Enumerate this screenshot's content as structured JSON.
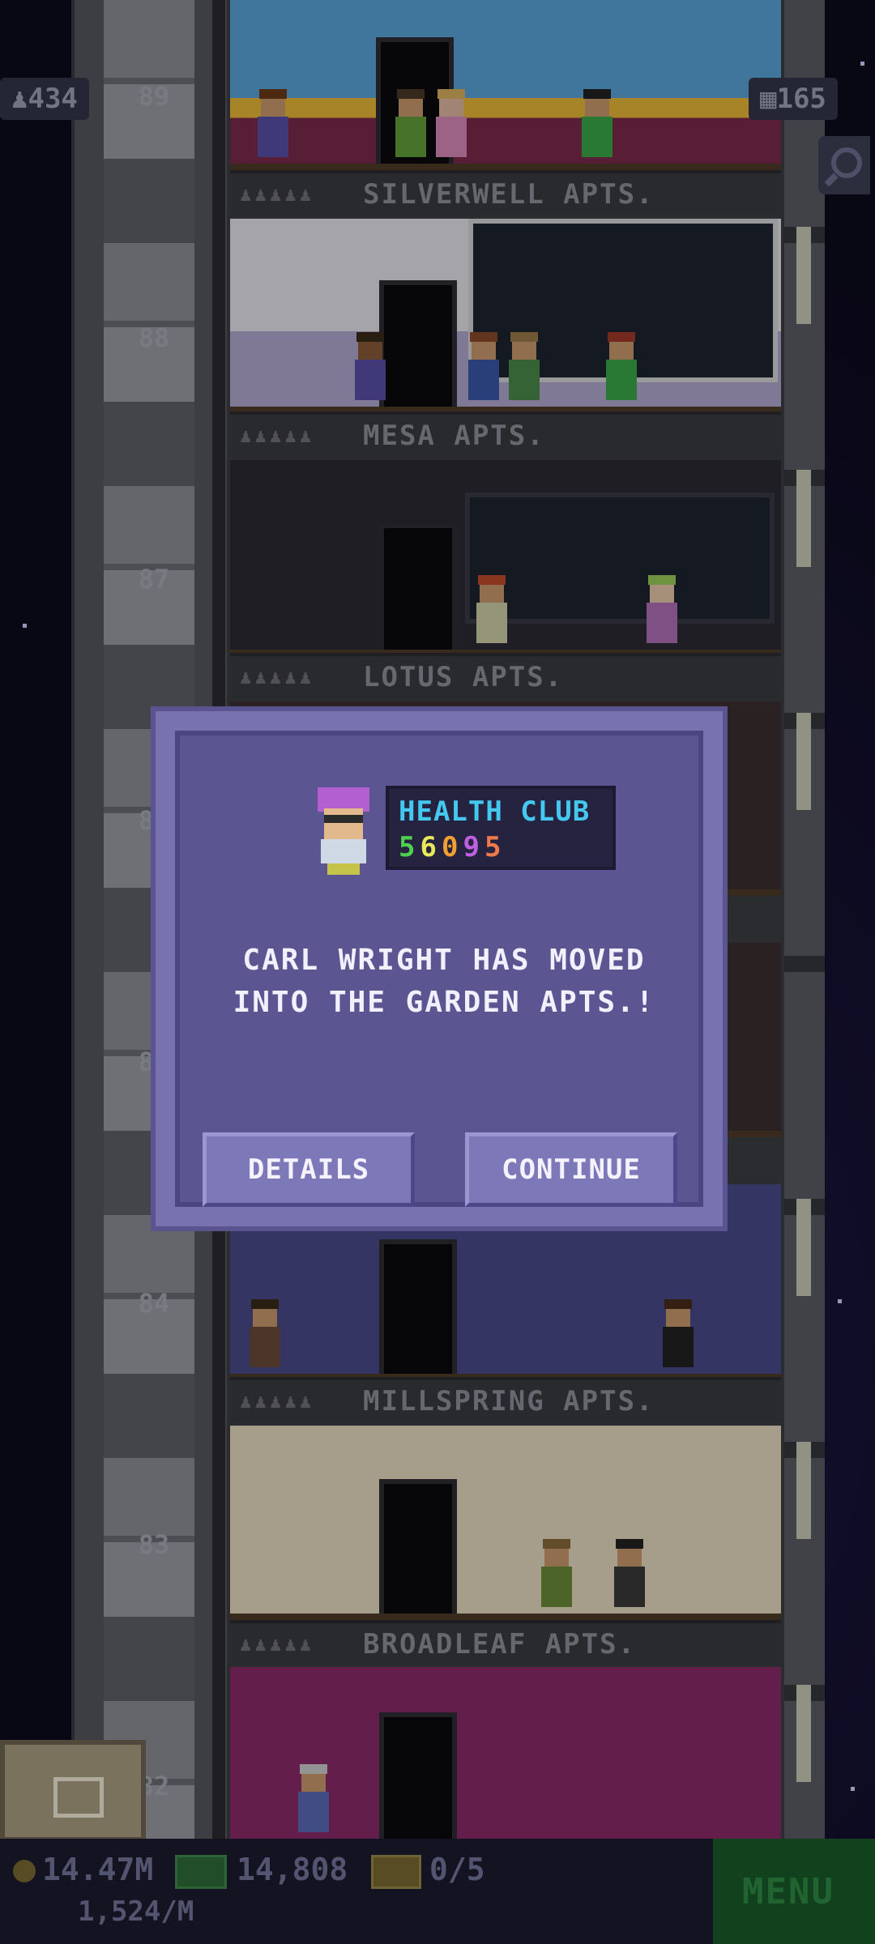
{
  "top_stats": {
    "population": "434",
    "floors": "165"
  },
  "shaft_floor_numbers": [
    "89",
    "88",
    "87",
    "86",
    "85",
    "84",
    "83",
    "82"
  ],
  "floor_labels": [
    {
      "name": "SILVERWELL APTS."
    },
    {
      "name": "MESA APTS."
    },
    {
      "name": "LOTUS APTS."
    },
    {
      "name": "MILLSPRING APTS."
    },
    {
      "name": "BROADLEAF APTS."
    }
  ],
  "dialog": {
    "business_name": "HEALTH CLUB",
    "business_digits": [
      "5",
      "6",
      "0",
      "9",
      "5"
    ],
    "digit_colors": [
      "#4fd14f",
      "#e8e85a",
      "#f0a030",
      "#c060e0",
      "#f07a4a"
    ],
    "message_line1": "CARL WRIGHT HAS MOVED",
    "message_line2": "INTO THE GARDEN APTS.!",
    "details_label": "DETAILS",
    "continue_label": "CONTINUE"
  },
  "bottom_bar": {
    "coins": "14.47M",
    "bux": "14,808",
    "tickets": "0/5",
    "income_rate": "1,524/M",
    "menu_label": "MENU"
  },
  "icons": {
    "population": "person-icon",
    "floors": "building-icon",
    "search": "magnifier-icon",
    "coins": "coin-icon",
    "bux": "cash-icon",
    "tickets": "ticket-icon"
  },
  "colors": {
    "dialog_bg": "#5b5691",
    "dialog_border": "#7872b0",
    "button_bg": "#7d78b8",
    "business_name": "#44c8f0",
    "menu_bg": "#1a5a2a"
  }
}
